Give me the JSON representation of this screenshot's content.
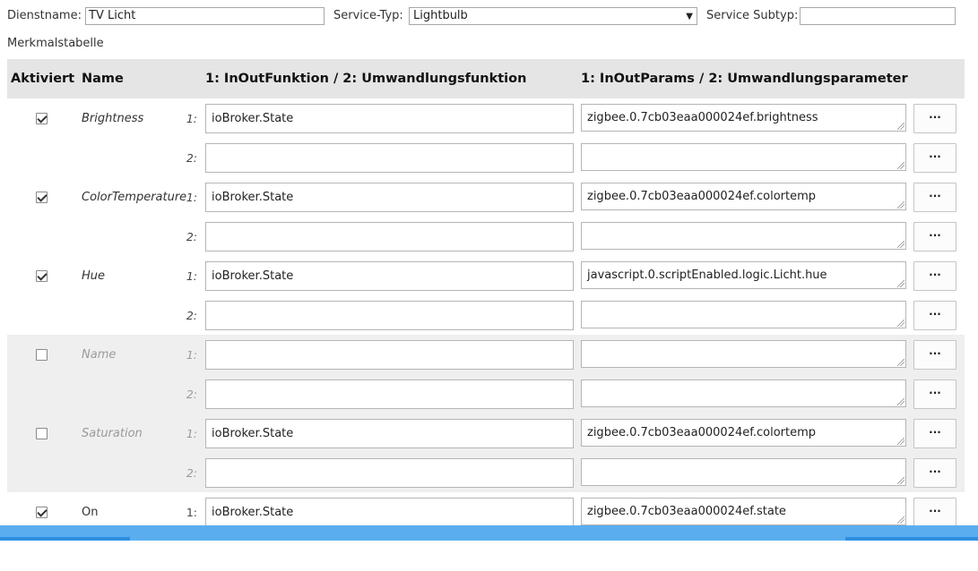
{
  "header": {
    "service_name_label": "Dienstname:",
    "service_name_value": "TV Licht",
    "service_type_label": "Service-Typ:",
    "service_type_value": "Lightbulb",
    "service_subtype_label": "Service Subtyp:",
    "service_subtype_value": ""
  },
  "section_title": "Merkmalstabelle",
  "table": {
    "headers": {
      "enabled": "Aktiviert",
      "name": "Name",
      "function": "1: InOutFunktion / 2: Umwandlungsfunktion",
      "params": "1: InOutParams / 2: Umwandlungsparameter"
    },
    "more_label": "···",
    "characteristics": [
      {
        "name": "Brightness",
        "enabled": true,
        "rows": [
          {
            "num": "1:",
            "function": "ioBroker.State",
            "params": "zigbee.0.7cb03eaa000024ef.brightness"
          },
          {
            "num": "2:",
            "function": "",
            "params": ""
          }
        ]
      },
      {
        "name": "ColorTemperature",
        "enabled": true,
        "rows": [
          {
            "num": "1:",
            "function": "ioBroker.State",
            "params": "zigbee.0.7cb03eaa000024ef.colortemp"
          },
          {
            "num": "2:",
            "function": "",
            "params": ""
          }
        ]
      },
      {
        "name": "Hue",
        "enabled": true,
        "rows": [
          {
            "num": "1:",
            "function": "ioBroker.State",
            "params": "javascript.0.scriptEnabled.logic.Licht.hue"
          },
          {
            "num": "2:",
            "function": "",
            "params": ""
          }
        ]
      },
      {
        "name": "Name",
        "enabled": false,
        "rows": [
          {
            "num": "1:",
            "function": "",
            "params": ""
          },
          {
            "num": "2:",
            "function": "",
            "params": ""
          }
        ]
      },
      {
        "name": "Saturation",
        "enabled": false,
        "rows": [
          {
            "num": "1:",
            "function": "ioBroker.State",
            "params": "zigbee.0.7cb03eaa000024ef.colortemp"
          },
          {
            "num": "2:",
            "function": "",
            "params": ""
          }
        ]
      },
      {
        "name": "On",
        "enabled": true,
        "rows": [
          {
            "num": "1:",
            "function": "ioBroker.State",
            "params": "zigbee.0.7cb03eaa000024ef.state"
          }
        ]
      }
    ]
  }
}
